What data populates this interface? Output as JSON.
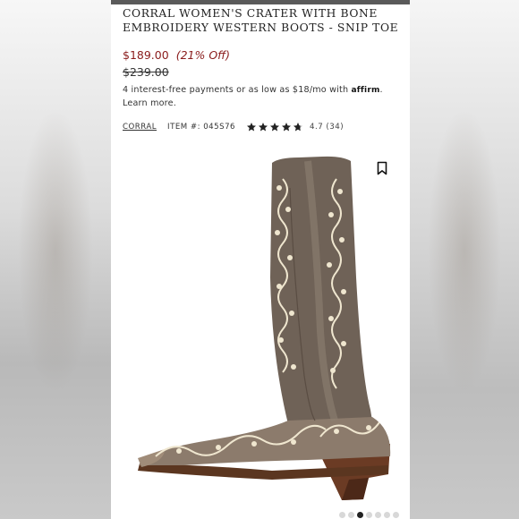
{
  "product": {
    "title": "CORRAL WOMEN'S CRATER WITH BONE EMBROIDERY WESTERN BOOTS - SNIP TOE",
    "price": "$189.00",
    "discount": "(21% Off)",
    "original_price": "$239.00",
    "affirm_text": "4 interest-free payments or as low as $18/mo with",
    "affirm_logo": "affirm",
    "affirm_suffix": ".",
    "learn_more": "Learn more.",
    "brand": "CORRAL",
    "item_number": "ITEM #: 045S76",
    "rating": "4.7 (34)",
    "stars": 4.7,
    "bookmark_icon": "bookmark-icon",
    "carousel_dots": 7,
    "active_dot": 3
  },
  "colors": {
    "price": "#8a1c1c",
    "topbar": "#5a5a5a",
    "boot_leather": "#6f6257",
    "embroidery": "#efe6cf"
  }
}
